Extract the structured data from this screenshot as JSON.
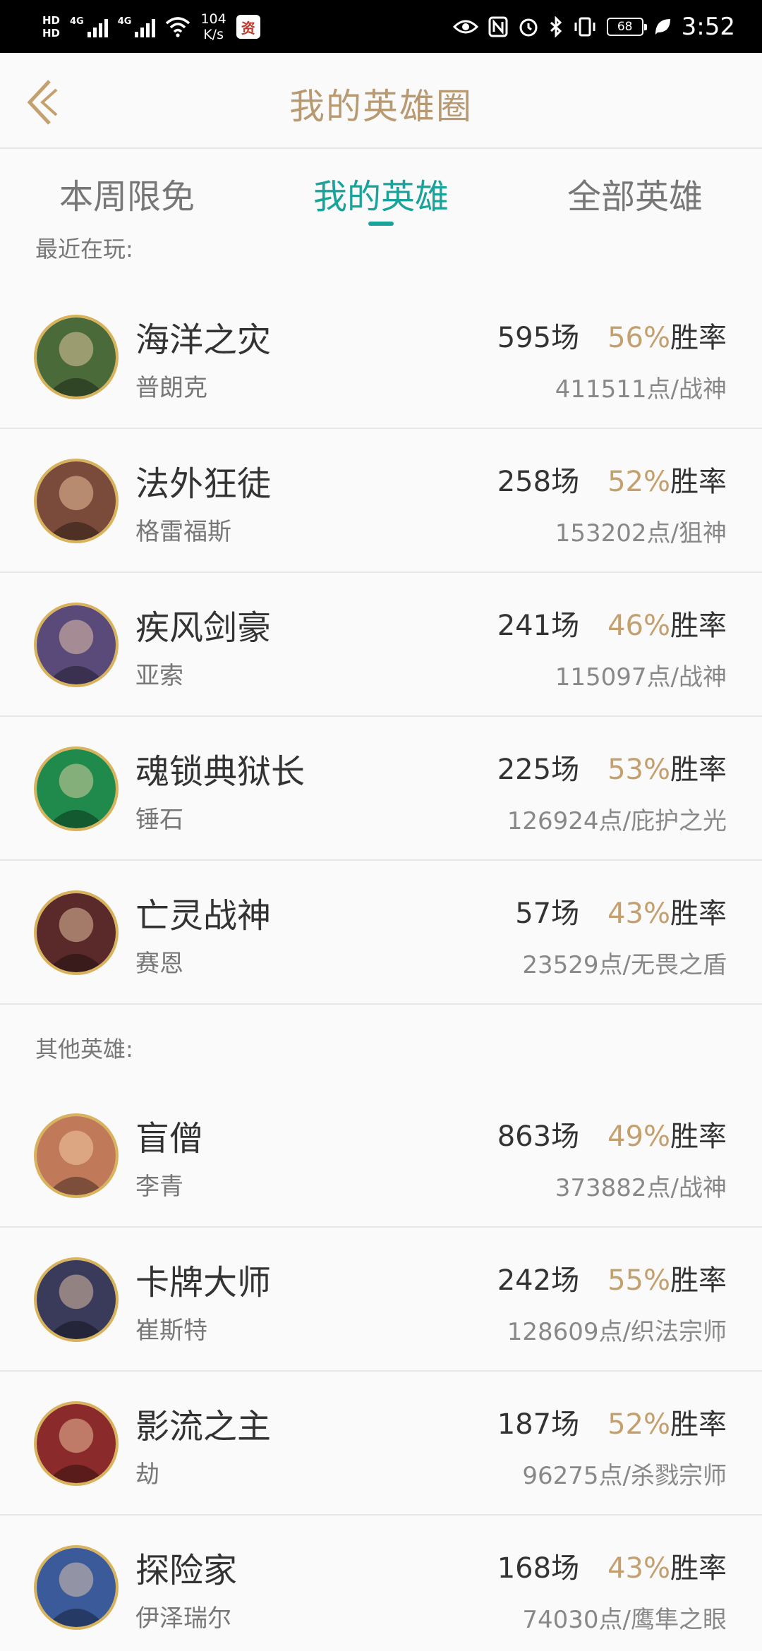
{
  "status_bar": {
    "hd1": "HD",
    "hd2": "HD",
    "net1": "4G",
    "net2": "4G",
    "speed_value": "104",
    "speed_unit": "K/s",
    "app_badge": "资",
    "battery": "68",
    "time": "3:52"
  },
  "header": {
    "title": "我的英雄圈"
  },
  "tabs": [
    {
      "label": "本周限免",
      "active": false
    },
    {
      "label": "我的英雄",
      "active": true
    },
    {
      "label": "全部英雄",
      "active": false
    }
  ],
  "sections": {
    "recent_label": "最近在玩:",
    "other_label": "其他英雄:"
  },
  "recent_heroes": [
    {
      "title": "海洋之灾",
      "name": "普朗克",
      "games": "595场",
      "rate": "56%",
      "rate_suffix": "胜率",
      "points": "411511点/战神",
      "avatar_color": "#4a6a3a"
    },
    {
      "title": "法外狂徒",
      "name": "格雷福斯",
      "games": "258场",
      "rate": "52%",
      "rate_suffix": "胜率",
      "points": "153202点/狙神",
      "avatar_color": "#7a4a3a"
    },
    {
      "title": "疾风剑豪",
      "name": "亚索",
      "games": "241场",
      "rate": "46%",
      "rate_suffix": "胜率",
      "points": "115097点/战神",
      "avatar_color": "#5a4a7a"
    },
    {
      "title": "魂锁典狱长",
      "name": "锤石",
      "games": "225场",
      "rate": "53%",
      "rate_suffix": "胜率",
      "points": "126924点/庇护之光",
      "avatar_color": "#1f8a4c"
    },
    {
      "title": "亡灵战神",
      "name": "赛恩",
      "games": "57场",
      "rate": "43%",
      "rate_suffix": "胜率",
      "points": "23529点/无畏之盾",
      "avatar_color": "#5a2a2a"
    }
  ],
  "other_heroes": [
    {
      "title": "盲僧",
      "name": "李青",
      "games": "863场",
      "rate": "49%",
      "rate_suffix": "胜率",
      "points": "373882点/战神",
      "avatar_color": "#c07a5a"
    },
    {
      "title": "卡牌大师",
      "name": "崔斯特",
      "games": "242场",
      "rate": "55%",
      "rate_suffix": "胜率",
      "points": "128609点/织法宗师",
      "avatar_color": "#3a3a5a"
    },
    {
      "title": "影流之主",
      "name": "劫",
      "games": "187场",
      "rate": "52%",
      "rate_suffix": "胜率",
      "points": "96275点/杀戮宗师",
      "avatar_color": "#8a2a2a"
    },
    {
      "title": "探险家",
      "name": "伊泽瑞尔",
      "games": "168场",
      "rate": "43%",
      "rate_suffix": "胜率",
      "points": "74030点/鹰隼之眼",
      "avatar_color": "#3a5a9a"
    }
  ],
  "colors": {
    "accent": "#1aa39a",
    "gold": "#b89a72",
    "rate": "#c3a06e",
    "avatar_border": "#d9b35c"
  }
}
